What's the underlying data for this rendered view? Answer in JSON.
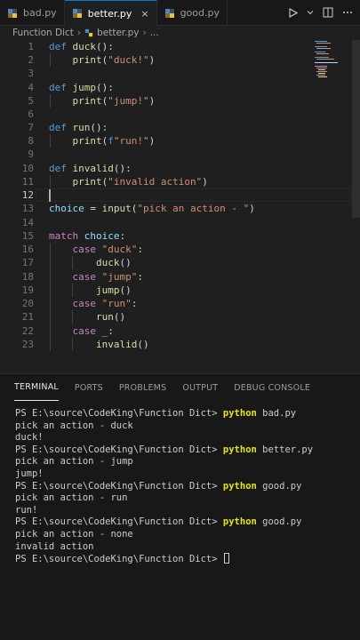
{
  "tabs": [
    {
      "label": "bad.py",
      "active": false
    },
    {
      "label": "better.py",
      "active": true
    },
    {
      "label": "good.py",
      "active": false
    }
  ],
  "tab_close": "×",
  "breadcrumb": {
    "folder": "Function Dict",
    "file": "better.py",
    "more": "..."
  },
  "code_lines": [
    {
      "n": "1"
    },
    {
      "n": "2"
    },
    {
      "n": "3"
    },
    {
      "n": "4"
    },
    {
      "n": "5"
    },
    {
      "n": "6"
    },
    {
      "n": "7"
    },
    {
      "n": "8"
    },
    {
      "n": "9"
    },
    {
      "n": "10"
    },
    {
      "n": "11"
    },
    {
      "n": "12"
    },
    {
      "n": "13"
    },
    {
      "n": "14"
    },
    {
      "n": "15"
    },
    {
      "n": "16"
    },
    {
      "n": "17"
    },
    {
      "n": "18"
    },
    {
      "n": "19"
    },
    {
      "n": "20"
    },
    {
      "n": "21"
    },
    {
      "n": "22"
    },
    {
      "n": "23"
    }
  ],
  "code": {
    "l1": {
      "kw": "def",
      "fn": "duck",
      "rest": "():"
    },
    "l2": {
      "fn": "print",
      "open": "(",
      "str": "\"duck!\"",
      "close": ")"
    },
    "l4": {
      "kw": "def",
      "fn": "jump",
      "rest": "():"
    },
    "l5": {
      "fn": "print",
      "open": "(",
      "str": "\"jump!\"",
      "close": ")"
    },
    "l7": {
      "kw": "def",
      "fn": "run",
      "rest": "():"
    },
    "l8": {
      "fn": "print",
      "open": "(",
      "fstr": "f",
      "str": "\"run!\"",
      "close": ")"
    },
    "l10": {
      "kw": "def",
      "fn": "invalid",
      "rest": "():"
    },
    "l11": {
      "fn": "print",
      "open": "(",
      "str": "\"invalid action\"",
      "close": ")"
    },
    "l13": {
      "var": "choice",
      "eq": " = ",
      "fn": "input",
      "open": "(",
      "str": "\"pick an action - \"",
      "close": ")"
    },
    "l15": {
      "kw": "match",
      "var": "choice",
      "colon": ":"
    },
    "l16": {
      "kw": "case",
      "str": "\"duck\"",
      "colon": ":"
    },
    "l17": {
      "fn": "duck",
      "call": "()"
    },
    "l18": {
      "kw": "case",
      "str": "\"jump\"",
      "colon": ":"
    },
    "l19": {
      "fn": "jump",
      "call": "()"
    },
    "l20": {
      "kw": "case",
      "str": "\"run\"",
      "colon": ":"
    },
    "l21": {
      "fn": "run",
      "call": "()"
    },
    "l22": {
      "kw": "case",
      "rest": "_:"
    },
    "l23": {
      "fn": "invalid",
      "call": "()"
    }
  },
  "panel_tabs": [
    "TERMINAL",
    "PORTS",
    "PROBLEMS",
    "OUTPUT",
    "DEBUG CONSOLE"
  ],
  "terminal": [
    {
      "prompt": "PS E:\\source\\CodeKing\\Function Dict> ",
      "cmd": "python",
      "arg": " bad.py"
    },
    {
      "out": "pick an action - duck"
    },
    {
      "out": "duck!"
    },
    {
      "prompt": "PS E:\\source\\CodeKing\\Function Dict> ",
      "cmd": "python",
      "arg": " better.py"
    },
    {
      "out": "pick an action - jump"
    },
    {
      "out": "jump!"
    },
    {
      "prompt": "PS E:\\source\\CodeKing\\Function Dict> ",
      "cmd": "python",
      "arg": " good.py"
    },
    {
      "out": "pick an action - run"
    },
    {
      "out": "run!"
    },
    {
      "prompt": "PS E:\\source\\CodeKing\\Function Dict> ",
      "cmd": "python",
      "arg": " good.py"
    },
    {
      "out": "pick an action - none"
    },
    {
      "out": "invalid action"
    },
    {
      "prompt": "PS E:\\source\\CodeKing\\Function Dict> ",
      "cmd": "",
      "arg": ""
    }
  ],
  "icons": {
    "python": "python-file-icon",
    "run": "run-icon",
    "split": "split-editor-icon",
    "more": "more-actions-icon"
  },
  "colors": {
    "keyword": "#569cd6",
    "control": "#c586c0",
    "function": "#dcdcaa",
    "string": "#ce9178",
    "variable": "#9cdcfe",
    "accent": "#0078d4"
  }
}
